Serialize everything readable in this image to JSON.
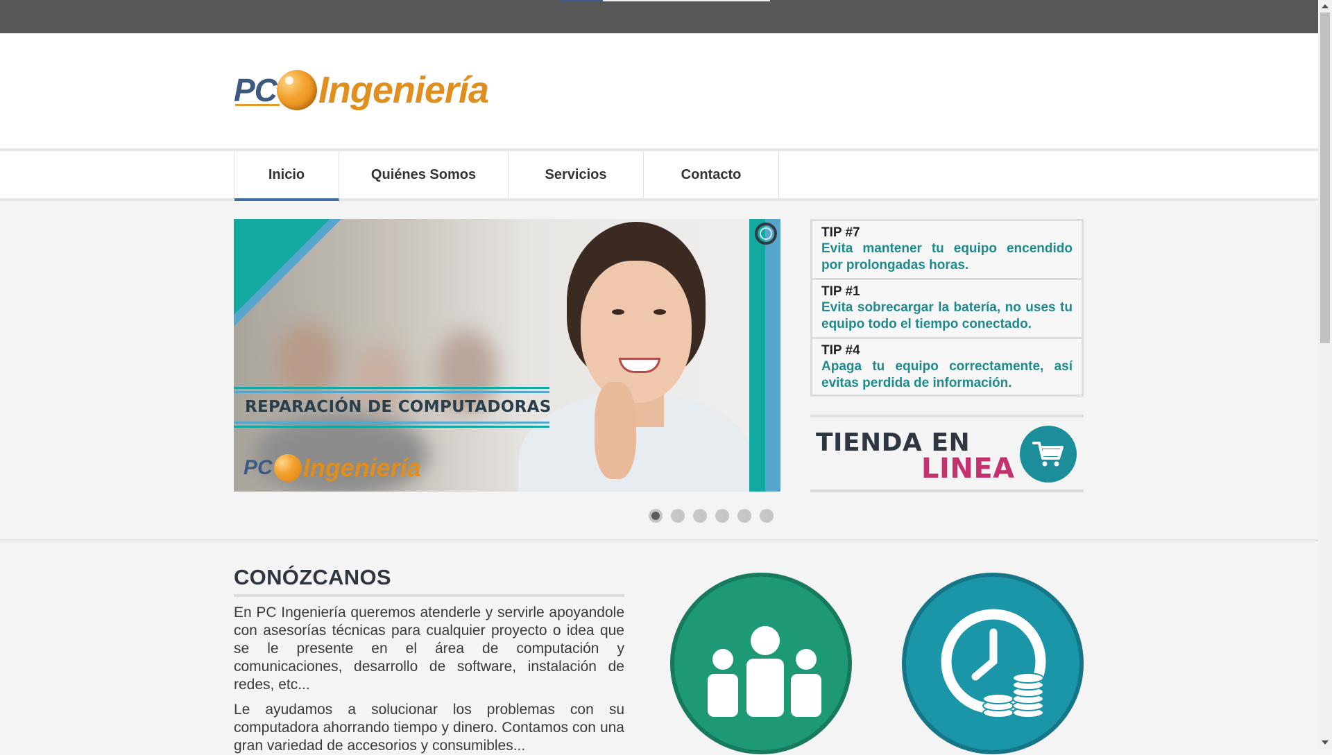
{
  "logo": {
    "pc": "PC",
    "name": "Ingeniería",
    "colors": {
      "pc": "#3d5a80",
      "name": "#e08f1e"
    }
  },
  "nav": {
    "items": [
      {
        "label": "Inicio",
        "active": true
      },
      {
        "label": "Quiénes Somos",
        "active": false
      },
      {
        "label": "Servicios",
        "active": false
      },
      {
        "label": "Contacto",
        "active": false
      }
    ],
    "active_color": "#3e6e9e"
  },
  "slider": {
    "caption": "REPARACIÓN DE COMPUTADORAS",
    "logo_pc": "PC",
    "logo_name": "Ingeniería",
    "slide_count": 6,
    "active_slide": 1
  },
  "tips": [
    {
      "title": "TIP #7",
      "text": "Evita mantener tu equipo encendido por prolongadas horas."
    },
    {
      "title": "TIP #1",
      "text": "Evita sobrecargar la batería, no uses tu equipo todo el tiempo conectado."
    },
    {
      "title": "TIP #4",
      "text": "Apaga tu equipo correctamente, así evitas perdida de información."
    }
  ],
  "store": {
    "line1": "TIENDA EN",
    "line2": "LINEA",
    "icon": "cart-icon"
  },
  "about": {
    "title": "CONÓZCANOS",
    "paragraphs": [
      "En PC Ingeniería queremos atenderle y servirle apoyandole con asesorías técnicas para cualquier proyecto o idea que se le presente en el área de computación y comunicaciones, desarrollo de software, instalación de redes, etc...",
      "Le ayudamos a solucionar los problemas con su computadora ahorrando tiempo y dinero. Contamos con una gran variedad de accesorios y consumibles..."
    ]
  },
  "feature_icons": [
    {
      "icon": "team-icon",
      "color": "#1e9976"
    },
    {
      "icon": "time-money-icon",
      "color": "#1b95a8"
    }
  ]
}
